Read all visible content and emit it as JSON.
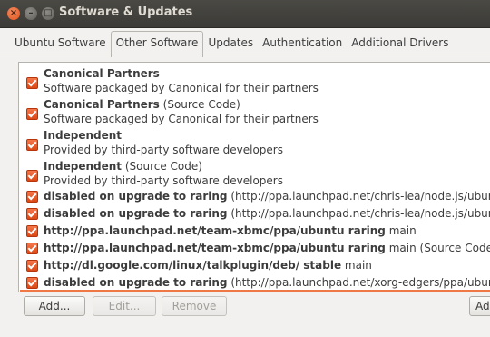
{
  "window": {
    "title": "Software & Updates"
  },
  "tabs": [
    {
      "label": "Ubuntu Software",
      "active": false
    },
    {
      "label": "Other Software",
      "active": true
    },
    {
      "label": "Updates",
      "active": false
    },
    {
      "label": "Authentication",
      "active": false
    },
    {
      "label": "Additional Drivers",
      "active": false
    }
  ],
  "sources": [
    {
      "checked": true,
      "name": "Canonical Partners",
      "suffix": "",
      "desc": "Software packaged by Canonical for their partners"
    },
    {
      "checked": true,
      "name": "Canonical Partners",
      "suffix": " (Source Code)",
      "desc": "Software packaged by Canonical for their partners"
    },
    {
      "checked": true,
      "name": "Independent",
      "suffix": "",
      "desc": "Provided by third-party software developers"
    },
    {
      "checked": true,
      "name": "Independent",
      "suffix": " (Source Code)",
      "desc": "Provided by third-party software developers"
    },
    {
      "checked": true,
      "name": " disabled on upgrade to raring",
      "suffix": " (http://ppa.launchpad.net/chris-lea/node.js/ubuntu rar"
    },
    {
      "checked": true,
      "name": " disabled on upgrade to raring",
      "suffix": " (http://ppa.launchpad.net/chris-lea/node.js/ubuntu rar"
    },
    {
      "checked": true,
      "name": "http://ppa.launchpad.net/team-xbmc/ppa/ubuntu raring",
      "suffix": " main"
    },
    {
      "checked": true,
      "name": "http://ppa.launchpad.net/team-xbmc/ppa/ubuntu raring",
      "suffix": " main (Source Code)"
    },
    {
      "checked": true,
      "name": "http://dl.google.com/linux/talkplugin/deb/ stable",
      "suffix": " main"
    },
    {
      "checked": true,
      "name": " disabled on upgrade to raring",
      "suffix": " (http://ppa.launchpad.net/xorg-edgers/ppa/ubuntu rar"
    }
  ],
  "buttons": {
    "add": "Add...",
    "edit": "Edit...",
    "remove": "Remove",
    "add_volume": "Ad"
  },
  "colors": {
    "accent": "#dd4814",
    "titlebar": "#3c3b37"
  }
}
